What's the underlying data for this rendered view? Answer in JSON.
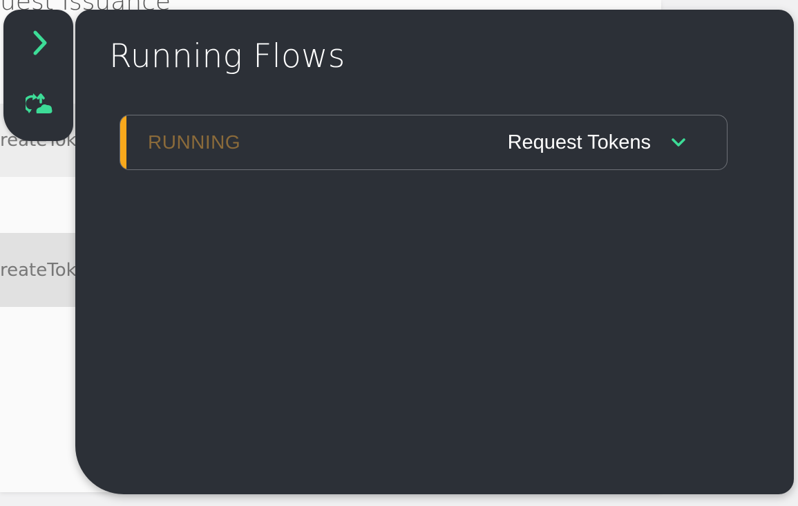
{
  "background": {
    "heading": "uest Issuance",
    "rows": [
      "reateTok",
      "reateTok"
    ]
  },
  "rail": {
    "expand_icon": "chevron-right-icon",
    "flows_icon": "running-flows-icon",
    "accent_color": "#3ddc97"
  },
  "panel": {
    "title": "Running Flows",
    "flows": [
      {
        "status": "RUNNING",
        "name": "Request Tokens",
        "status_color": "#f8a81c",
        "expand_icon": "chevron-down-icon"
      }
    ]
  }
}
